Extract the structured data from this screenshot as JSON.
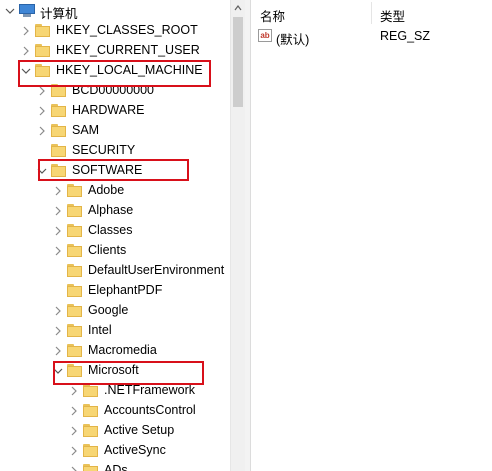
{
  "tree": {
    "root_label": "计算机",
    "items": [
      {
        "label": "HKEY_CLASSES_ROOT",
        "level": 1,
        "arrow": "right"
      },
      {
        "label": "HKEY_CURRENT_USER",
        "level": 1,
        "arrow": "right"
      },
      {
        "label": "HKEY_LOCAL_MACHINE",
        "level": 1,
        "arrow": "down"
      },
      {
        "label": "BCD00000000",
        "level": 2,
        "arrow": "right"
      },
      {
        "label": "HARDWARE",
        "level": 2,
        "arrow": "right"
      },
      {
        "label": "SAM",
        "level": 2,
        "arrow": "right"
      },
      {
        "label": "SECURITY",
        "level": 2,
        "arrow": "none"
      },
      {
        "label": "SOFTWARE",
        "level": 2,
        "arrow": "down"
      },
      {
        "label": "Adobe",
        "level": 3,
        "arrow": "right"
      },
      {
        "label": "Alphase",
        "level": 3,
        "arrow": "right"
      },
      {
        "label": "Classes",
        "level": 3,
        "arrow": "right"
      },
      {
        "label": "Clients",
        "level": 3,
        "arrow": "right"
      },
      {
        "label": "DefaultUserEnvironment",
        "level": 3,
        "arrow": "none"
      },
      {
        "label": "ElephantPDF",
        "level": 3,
        "arrow": "none"
      },
      {
        "label": "Google",
        "level": 3,
        "arrow": "right"
      },
      {
        "label": "Intel",
        "level": 3,
        "arrow": "right"
      },
      {
        "label": "Macromedia",
        "level": 3,
        "arrow": "right"
      },
      {
        "label": "Microsoft",
        "level": 3,
        "arrow": "down"
      },
      {
        "label": ".NETFramework",
        "level": 4,
        "arrow": "right"
      },
      {
        "label": "AccountsControl",
        "level": 4,
        "arrow": "right"
      },
      {
        "label": "Active Setup",
        "level": 4,
        "arrow": "right"
      },
      {
        "label": "ActiveSync",
        "level": 4,
        "arrow": "right"
      },
      {
        "label": "ADs",
        "level": 4,
        "arrow": "right"
      }
    ]
  },
  "list": {
    "col_name": "名称",
    "col_type": "类型",
    "rows": [
      {
        "name": "(默认)",
        "type": "REG_SZ",
        "icon": "string-value-icon",
        "icon_text": "ab"
      }
    ]
  },
  "colors": {
    "highlight": "#d8101a",
    "folder": "#f7d674",
    "computer": "#3f86d6"
  }
}
